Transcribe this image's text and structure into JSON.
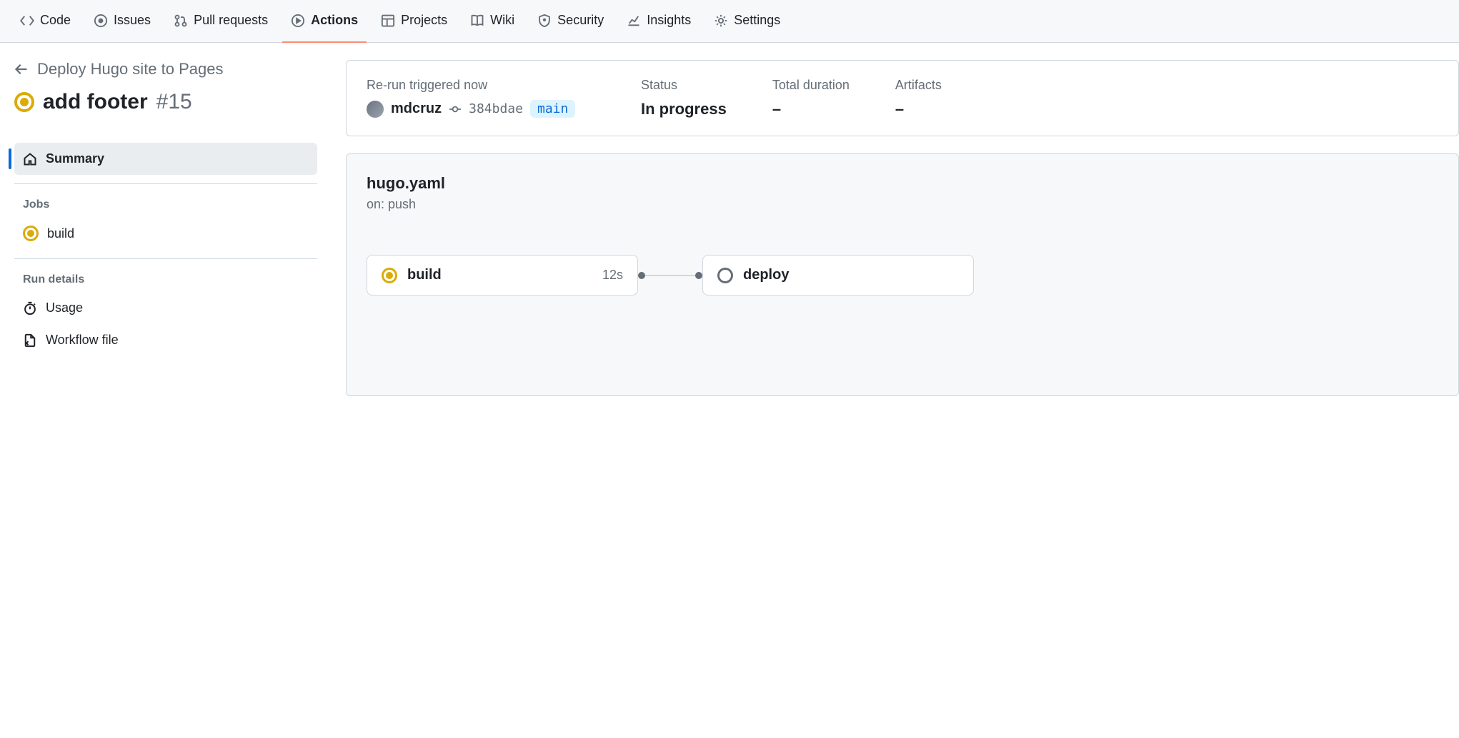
{
  "nav": {
    "code": "Code",
    "issues": "Issues",
    "pulls": "Pull requests",
    "actions": "Actions",
    "projects": "Projects",
    "wiki": "Wiki",
    "security": "Security",
    "insights": "Insights",
    "settings": "Settings"
  },
  "breadcrumb": {
    "workflow": "Deploy Hugo site to Pages"
  },
  "run": {
    "title": "add footer",
    "number": "#15"
  },
  "sidebar": {
    "summary": "Summary",
    "jobs_heading": "Jobs",
    "jobs": [
      {
        "name": "build"
      }
    ],
    "details_heading": "Run details",
    "usage": "Usage",
    "workflow_file": "Workflow file"
  },
  "summary": {
    "trigger_label": "Re-run triggered now",
    "actor": "mdcruz",
    "sha": "384bdae",
    "branch": "main",
    "status_label": "Status",
    "status_value": "In progress",
    "duration_label": "Total duration",
    "duration_value": "–",
    "artifacts_label": "Artifacts",
    "artifacts_value": "–"
  },
  "workflow": {
    "file": "hugo.yaml",
    "trigger": "on: push",
    "jobs": [
      {
        "name": "build",
        "duration": "12s",
        "status": "in_progress"
      },
      {
        "name": "deploy",
        "duration": "",
        "status": "queued"
      }
    ]
  }
}
